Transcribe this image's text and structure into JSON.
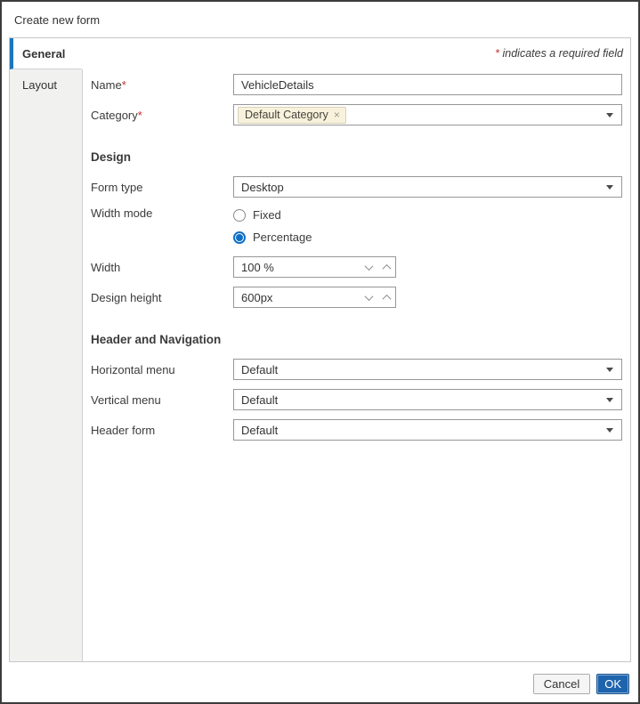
{
  "window": {
    "title": "Create new form"
  },
  "colors": {
    "accent_tab_blue": "#1d76bd",
    "ok_button_blue": "#1e64ad",
    "required_red": "#c22f2f",
    "chip_bg": "#f8f2dc",
    "sidebar_bg": "#f1f1f0",
    "radio_selected_blue": "#0f6fc5"
  },
  "tabs": {
    "general": "General",
    "layout": "Layout"
  },
  "required_note": {
    "asterisk": "*",
    "text": "indicates a required field"
  },
  "fields": {
    "name": {
      "label": "Name",
      "required_mark": "*",
      "value": "VehicleDetails"
    },
    "category": {
      "label": "Category",
      "required_mark": "*",
      "selected_tag": "Default Category",
      "remove_icon": "×"
    }
  },
  "design_section": {
    "title": "Design",
    "form_type": {
      "label": "Form type",
      "value": "Desktop"
    },
    "width_mode": {
      "label": "Width mode",
      "options": [
        {
          "label": "Fixed",
          "selected": false
        },
        {
          "label": "Percentage",
          "selected": true
        }
      ]
    },
    "width": {
      "label": "Width",
      "value": "100 %"
    },
    "design_height": {
      "label": "Design height",
      "value": "600px"
    }
  },
  "header_nav_section": {
    "title": "Header and Navigation",
    "horizontal_menu": {
      "label": "Horizontal menu",
      "value": "Default"
    },
    "vertical_menu": {
      "label": "Vertical menu",
      "value": "Default"
    },
    "header_form": {
      "label": "Header form",
      "value": "Default"
    }
  },
  "footer": {
    "cancel": "Cancel",
    "ok": "OK"
  }
}
